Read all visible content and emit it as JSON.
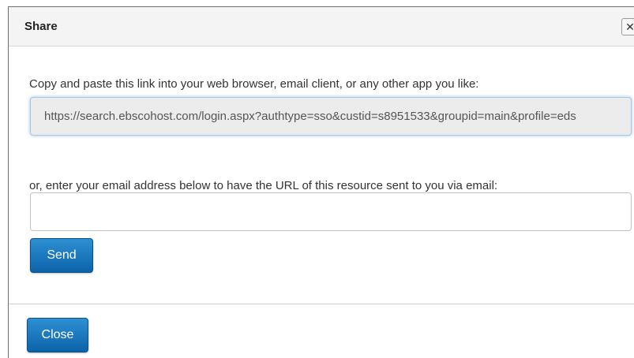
{
  "dialog": {
    "title": "Share",
    "close_icon_glyph": "✕"
  },
  "share_link": {
    "instruction": "Copy and paste this link into your web browser, email client, or any other app you like:",
    "url": "https://search.ebscohost.com/login.aspx?authtype=sso&custid=s8951533&groupid=main&profile=eds"
  },
  "email": {
    "instruction": "or, enter your email address below to have the URL of this resource sent to you via email:",
    "value": "",
    "placeholder": ""
  },
  "buttons": {
    "send_label": "Send",
    "close_label": "Close"
  },
  "colors": {
    "button_primary": "#1a75bc",
    "link_field_bg": "#ececec",
    "header_bg": "#f4f4f4"
  }
}
